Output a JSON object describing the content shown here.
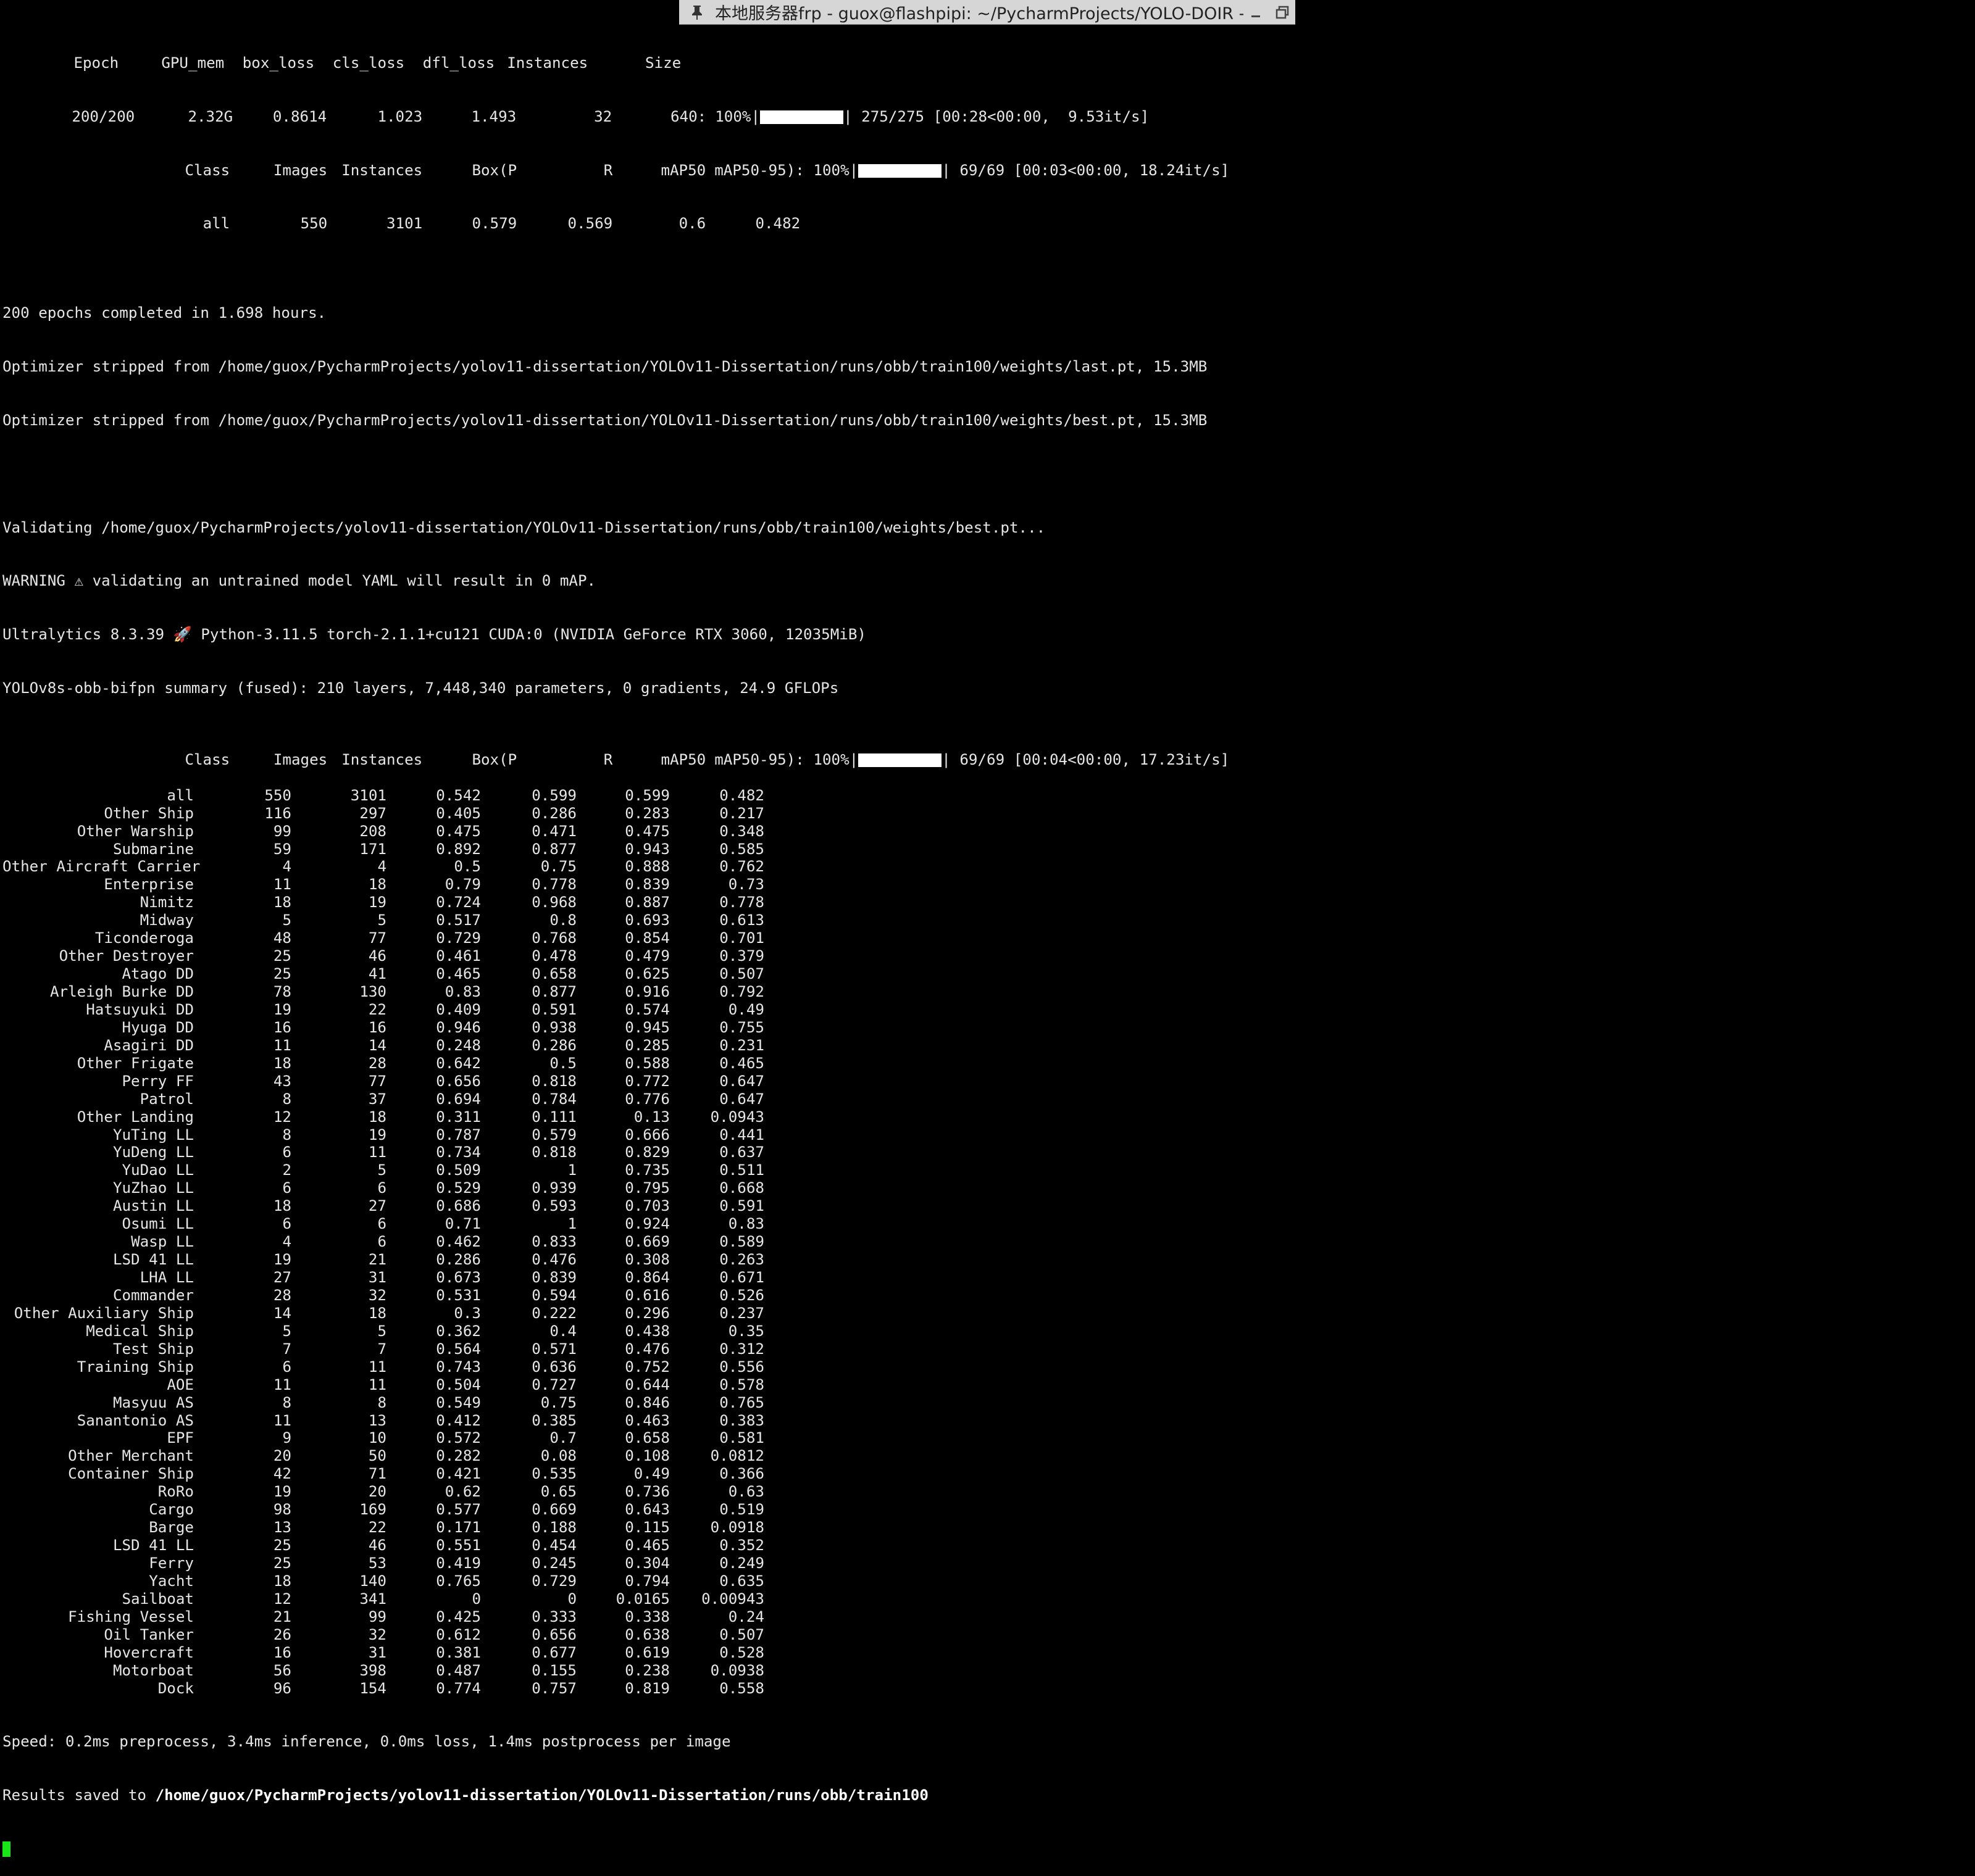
{
  "window": {
    "title": "本地服务器frp - guox@flashpipi: ~/PycharmProjects/YOLO-DOIR -",
    "icons": [
      "pin-icon",
      "minimize-icon",
      "restore-icon"
    ]
  },
  "train_header": {
    "columns": [
      "Epoch",
      "GPU_mem",
      "box_loss",
      "cls_loss",
      "dfl_loss",
      "Instances",
      "Size"
    ],
    "values": [
      "200/200",
      "2.32G",
      "0.8614",
      "1.023",
      "1.493",
      "32",
      "640:"
    ],
    "progress_text": "100%|",
    "progress_fraction": 1.0,
    "progress_stats": "| 275/275 [00:28<00:00,  9.53it/s]"
  },
  "val_header_1": {
    "columns": [
      "Class",
      "Images",
      "Instances",
      "Box(P",
      "R",
      "mAP50",
      "mAP50-95): 100%|"
    ],
    "progress_fraction": 1.0,
    "progress_stats": "| 69/69 [00:03<00:00, 18.24it/s]",
    "all_row": [
      "all",
      "550",
      "3101",
      "0.579",
      "0.569",
      "0.6",
      "0.482"
    ]
  },
  "log_lines": [
    "200 epochs completed in 1.698 hours.",
    "Optimizer stripped from /home/guox/PycharmProjects/yolov11-dissertation/YOLOv11-Dissertation/runs/obb/train100/weights/last.pt, 15.3MB",
    "Optimizer stripped from /home/guox/PycharmProjects/yolov11-dissertation/YOLOv11-Dissertation/runs/obb/train100/weights/best.pt, 15.3MB"
  ],
  "validate_lines": [
    "Validating /home/guox/PycharmProjects/yolov11-dissertation/YOLOv11-Dissertation/runs/obb/train100/weights/best.pt...",
    "WARNING ⚠ validating an untrained model YAML will result in 0 mAP.",
    "Ultralytics 8.3.39 🚀 Python-3.11.5 torch-2.1.1+cu121 CUDA:0 (NVIDIA GeForce RTX 3060, 12035MiB)",
    "YOLOv8s-obb-bifpn summary (fused): 210 layers, 7,448,340 parameters, 0 gradients, 24.9 GFLOPs"
  ],
  "val_header_2": {
    "columns": [
      "Class",
      "Images",
      "Instances",
      "Box(P",
      "R",
      "mAP50",
      "mAP50-95): 100%|"
    ],
    "progress_fraction": 1.0,
    "progress_stats": "| 69/69 [00:04<00:00, 17.23it/s]"
  },
  "results": [
    [
      "all",
      "550",
      "3101",
      "0.542",
      "0.599",
      "0.599",
      "0.482"
    ],
    [
      "Other Ship",
      "116",
      "297",
      "0.405",
      "0.286",
      "0.283",
      "0.217"
    ],
    [
      "Other Warship",
      "99",
      "208",
      "0.475",
      "0.471",
      "0.475",
      "0.348"
    ],
    [
      "Submarine",
      "59",
      "171",
      "0.892",
      "0.877",
      "0.943",
      "0.585"
    ],
    [
      "Other Aircraft Carrier",
      "4",
      "4",
      "0.5",
      "0.75",
      "0.888",
      "0.762"
    ],
    [
      "Enterprise",
      "11",
      "18",
      "0.79",
      "0.778",
      "0.839",
      "0.73"
    ],
    [
      "Nimitz",
      "18",
      "19",
      "0.724",
      "0.968",
      "0.887",
      "0.778"
    ],
    [
      "Midway",
      "5",
      "5",
      "0.517",
      "0.8",
      "0.693",
      "0.613"
    ],
    [
      "Ticonderoga",
      "48",
      "77",
      "0.729",
      "0.768",
      "0.854",
      "0.701"
    ],
    [
      "Other Destroyer",
      "25",
      "46",
      "0.461",
      "0.478",
      "0.479",
      "0.379"
    ],
    [
      "Atago DD",
      "25",
      "41",
      "0.465",
      "0.658",
      "0.625",
      "0.507"
    ],
    [
      "Arleigh Burke DD",
      "78",
      "130",
      "0.83",
      "0.877",
      "0.916",
      "0.792"
    ],
    [
      "Hatsuyuki DD",
      "19",
      "22",
      "0.409",
      "0.591",
      "0.574",
      "0.49"
    ],
    [
      "Hyuga DD",
      "16",
      "16",
      "0.946",
      "0.938",
      "0.945",
      "0.755"
    ],
    [
      "Asagiri DD",
      "11",
      "14",
      "0.248",
      "0.286",
      "0.285",
      "0.231"
    ],
    [
      "Other Frigate",
      "18",
      "28",
      "0.642",
      "0.5",
      "0.588",
      "0.465"
    ],
    [
      "Perry FF",
      "43",
      "77",
      "0.656",
      "0.818",
      "0.772",
      "0.647"
    ],
    [
      "Patrol",
      "8",
      "37",
      "0.694",
      "0.784",
      "0.776",
      "0.647"
    ],
    [
      "Other Landing",
      "12",
      "18",
      "0.311",
      "0.111",
      "0.13",
      "0.0943"
    ],
    [
      "YuTing LL",
      "8",
      "19",
      "0.787",
      "0.579",
      "0.666",
      "0.441"
    ],
    [
      "YuDeng LL",
      "6",
      "11",
      "0.734",
      "0.818",
      "0.829",
      "0.637"
    ],
    [
      "YuDao LL",
      "2",
      "5",
      "0.509",
      "1",
      "0.735",
      "0.511"
    ],
    [
      "YuZhao LL",
      "6",
      "6",
      "0.529",
      "0.939",
      "0.795",
      "0.668"
    ],
    [
      "Austin LL",
      "18",
      "27",
      "0.686",
      "0.593",
      "0.703",
      "0.591"
    ],
    [
      "Osumi LL",
      "6",
      "6",
      "0.71",
      "1",
      "0.924",
      "0.83"
    ],
    [
      "Wasp LL",
      "4",
      "6",
      "0.462",
      "0.833",
      "0.669",
      "0.589"
    ],
    [
      "LSD 41 LL",
      "19",
      "21",
      "0.286",
      "0.476",
      "0.308",
      "0.263"
    ],
    [
      "LHA LL",
      "27",
      "31",
      "0.673",
      "0.839",
      "0.864",
      "0.671"
    ],
    [
      "Commander",
      "28",
      "32",
      "0.531",
      "0.594",
      "0.616",
      "0.526"
    ],
    [
      "Other Auxiliary Ship",
      "14",
      "18",
      "0.3",
      "0.222",
      "0.296",
      "0.237"
    ],
    [
      "Medical Ship",
      "5",
      "5",
      "0.362",
      "0.4",
      "0.438",
      "0.35"
    ],
    [
      "Test Ship",
      "7",
      "7",
      "0.564",
      "0.571",
      "0.476",
      "0.312"
    ],
    [
      "Training Ship",
      "6",
      "11",
      "0.743",
      "0.636",
      "0.752",
      "0.556"
    ],
    [
      "AOE",
      "11",
      "11",
      "0.504",
      "0.727",
      "0.644",
      "0.578"
    ],
    [
      "Masyuu AS",
      "8",
      "8",
      "0.549",
      "0.75",
      "0.846",
      "0.765"
    ],
    [
      "Sanantonio AS",
      "11",
      "13",
      "0.412",
      "0.385",
      "0.463",
      "0.383"
    ],
    [
      "EPF",
      "9",
      "10",
      "0.572",
      "0.7",
      "0.658",
      "0.581"
    ],
    [
      "Other Merchant",
      "20",
      "50",
      "0.282",
      "0.08",
      "0.108",
      "0.0812"
    ],
    [
      "Container Ship",
      "42",
      "71",
      "0.421",
      "0.535",
      "0.49",
      "0.366"
    ],
    [
      "RoRo",
      "19",
      "20",
      "0.62",
      "0.65",
      "0.736",
      "0.63"
    ],
    [
      "Cargo",
      "98",
      "169",
      "0.577",
      "0.669",
      "0.643",
      "0.519"
    ],
    [
      "Barge",
      "13",
      "22",
      "0.171",
      "0.188",
      "0.115",
      "0.0918"
    ],
    [
      "LSD 41 LL",
      "25",
      "46",
      "0.551",
      "0.454",
      "0.465",
      "0.352"
    ],
    [
      "Ferry",
      "25",
      "53",
      "0.419",
      "0.245",
      "0.304",
      "0.249"
    ],
    [
      "Yacht",
      "18",
      "140",
      "0.765",
      "0.729",
      "0.794",
      "0.635"
    ],
    [
      "Sailboat",
      "12",
      "341",
      "0",
      "0",
      "0.0165",
      "0.00943"
    ],
    [
      "Fishing Vessel",
      "21",
      "99",
      "0.425",
      "0.333",
      "0.338",
      "0.24"
    ],
    [
      "Oil Tanker",
      "26",
      "32",
      "0.612",
      "0.656",
      "0.638",
      "0.507"
    ],
    [
      "Hovercraft",
      "16",
      "31",
      "0.381",
      "0.677",
      "0.619",
      "0.528"
    ],
    [
      "Motorboat",
      "56",
      "398",
      "0.487",
      "0.155",
      "0.238",
      "0.0938"
    ],
    [
      "Dock",
      "96",
      "154",
      "0.774",
      "0.757",
      "0.819",
      "0.558"
    ]
  ],
  "footer": {
    "speed": "Speed: 0.2ms preprocess, 3.4ms inference, 0.0ms loss, 1.4ms postprocess per image",
    "results_prefix": "Results saved to ",
    "results_path": "/home/guox/PycharmProjects/yolov11-dissertation/YOLOv11-Dissertation/runs/obb/train100"
  },
  "colors": {
    "background": "#000000",
    "text": "#e6e6e6",
    "cursor": "#19e619",
    "titlebar": "#d6d6d6"
  }
}
